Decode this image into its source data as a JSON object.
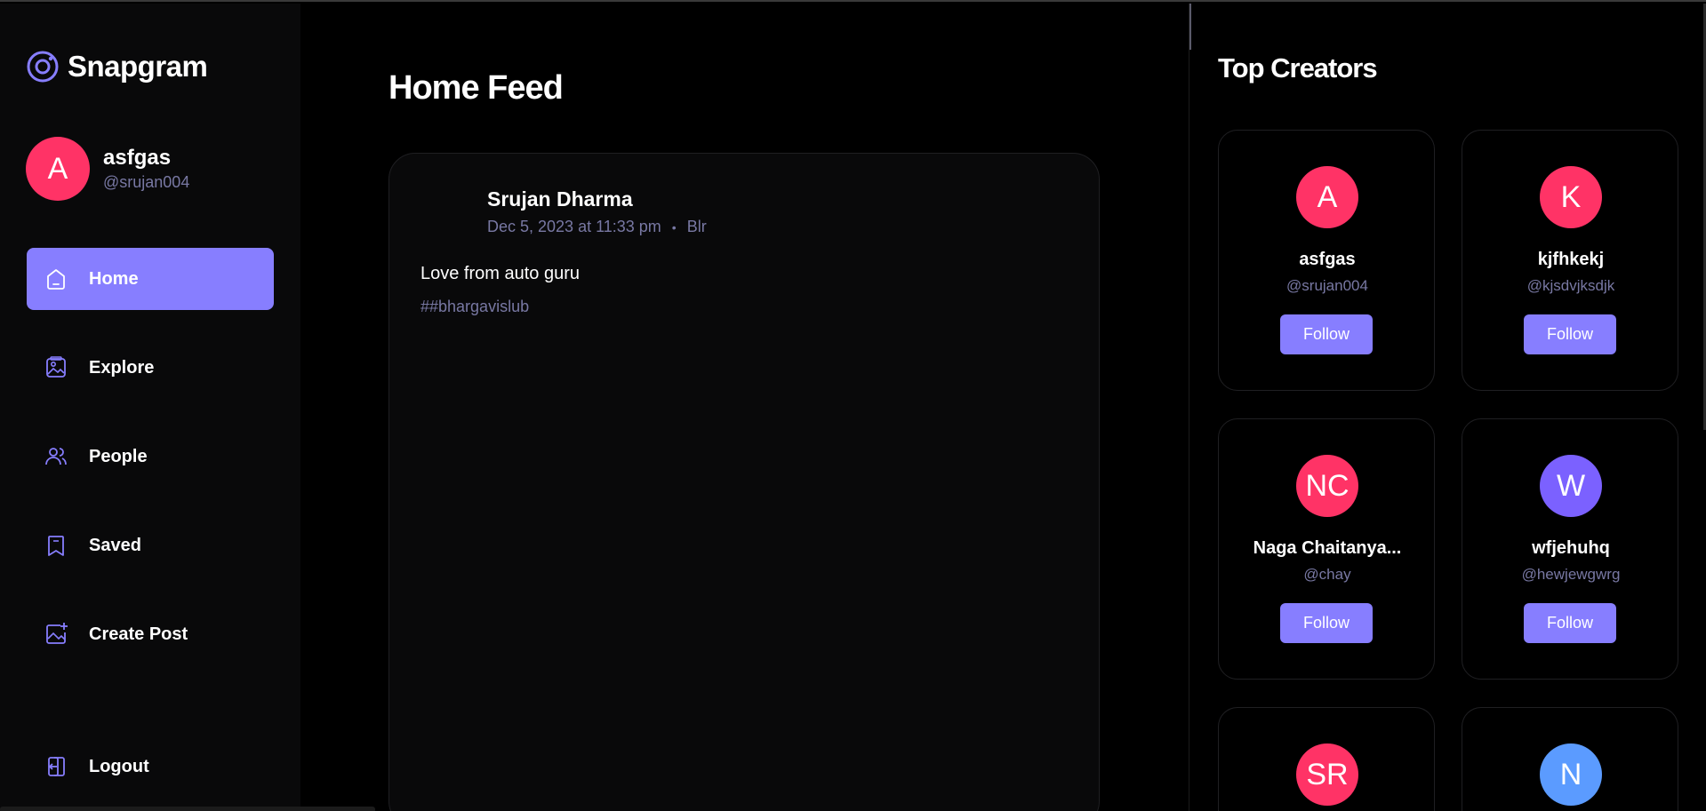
{
  "app": {
    "name": "Snapgram",
    "accent": "#877eff",
    "avatar_color": "#ff3366"
  },
  "user": {
    "initial": "A",
    "name": "asfgas",
    "handle": "@srujan004"
  },
  "nav": {
    "items": [
      {
        "label": "Home",
        "icon": "home-icon",
        "active": true
      },
      {
        "label": "Explore",
        "icon": "gallery-icon",
        "active": false
      },
      {
        "label": "People",
        "icon": "people-icon",
        "active": false
      },
      {
        "label": "Saved",
        "icon": "bookmark-icon",
        "active": false
      },
      {
        "label": "Create Post",
        "icon": "image-add-icon",
        "active": false
      }
    ],
    "logout": "Logout"
  },
  "feed": {
    "title": "Home Feed",
    "posts": [
      {
        "author": "Srujan Dharma",
        "date": "Dec 5, 2023 at 11:33 pm",
        "separator": "•",
        "location": "Blr",
        "caption": "Love from auto guru",
        "tag": "##bhargavislub"
      }
    ]
  },
  "top_creators": {
    "title": "Top Creators",
    "follow_label": "Follow",
    "creators": [
      {
        "initials": "A",
        "name": "asfgas",
        "handle": "@srujan004",
        "color": "#ff3366"
      },
      {
        "initials": "K",
        "name": "kjfhkekj",
        "handle": "@kjsdvjksdjk",
        "color": "#ff3366"
      },
      {
        "initials": "NC",
        "name": "Naga Chaitanya...",
        "handle": "@chay",
        "color": "#ff3366"
      },
      {
        "initials": "W",
        "name": "wfjehuhq",
        "handle": "@hewjewgwrg",
        "color": "#7b61ff"
      },
      {
        "initials": "SR",
        "name": "",
        "handle": "",
        "color": "#ff3366"
      },
      {
        "initials": "N",
        "name": "",
        "handle": "",
        "color": "#5b9bff"
      }
    ]
  }
}
